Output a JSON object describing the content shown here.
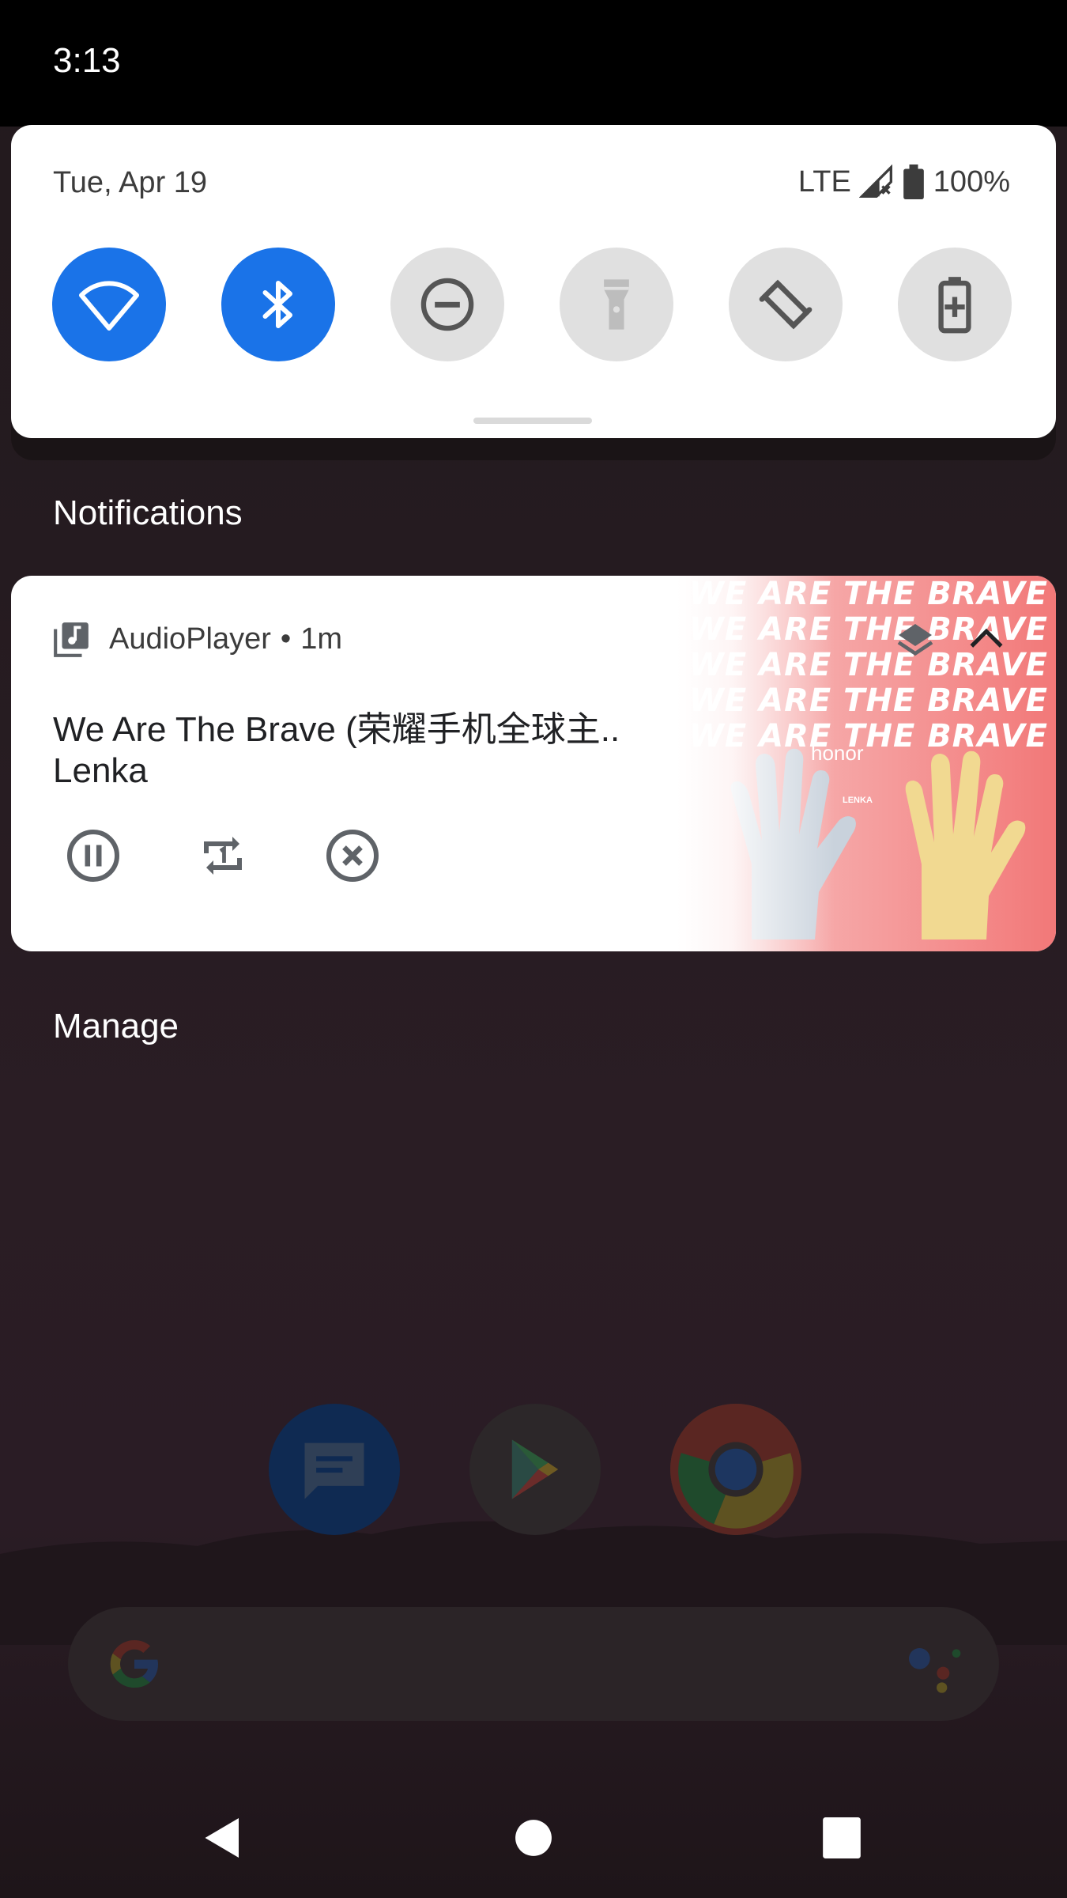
{
  "status_bar": {
    "time": "3:13"
  },
  "quick_settings": {
    "date": "Tue, Apr 19",
    "network": "LTE",
    "battery": "100%",
    "tiles": [
      {
        "name": "wifi",
        "state": "on"
      },
      {
        "name": "bluetooth",
        "state": "on"
      },
      {
        "name": "do-not-disturb",
        "state": "off"
      },
      {
        "name": "flashlight",
        "state": "off"
      },
      {
        "name": "auto-rotate",
        "state": "off"
      },
      {
        "name": "battery-saver",
        "state": "off"
      }
    ]
  },
  "notifications": {
    "header": "Notifications",
    "media": {
      "app_name": "AudioPlayer",
      "time": "1m",
      "separator": "•",
      "title": "We Are The Brave (荣耀手机全球主..",
      "artist": "Lenka",
      "album_art_lines": [
        "WE ARE THE BRAVE",
        "WE ARE THE BRAVE",
        "WE ARE THE BRAVE",
        "WE ARE THE BRAVE",
        "WE ARE THE BRAVE"
      ],
      "album_art_brand": "honor",
      "album_art_artist": "LENKA",
      "controls": [
        "pause-icon",
        "repeat-one-icon",
        "close-icon"
      ]
    },
    "manage_label": "Manage"
  },
  "colors": {
    "accent": "#1a73e8",
    "tile_off": "#e0e0e0",
    "card_bg": "#ffffff"
  }
}
